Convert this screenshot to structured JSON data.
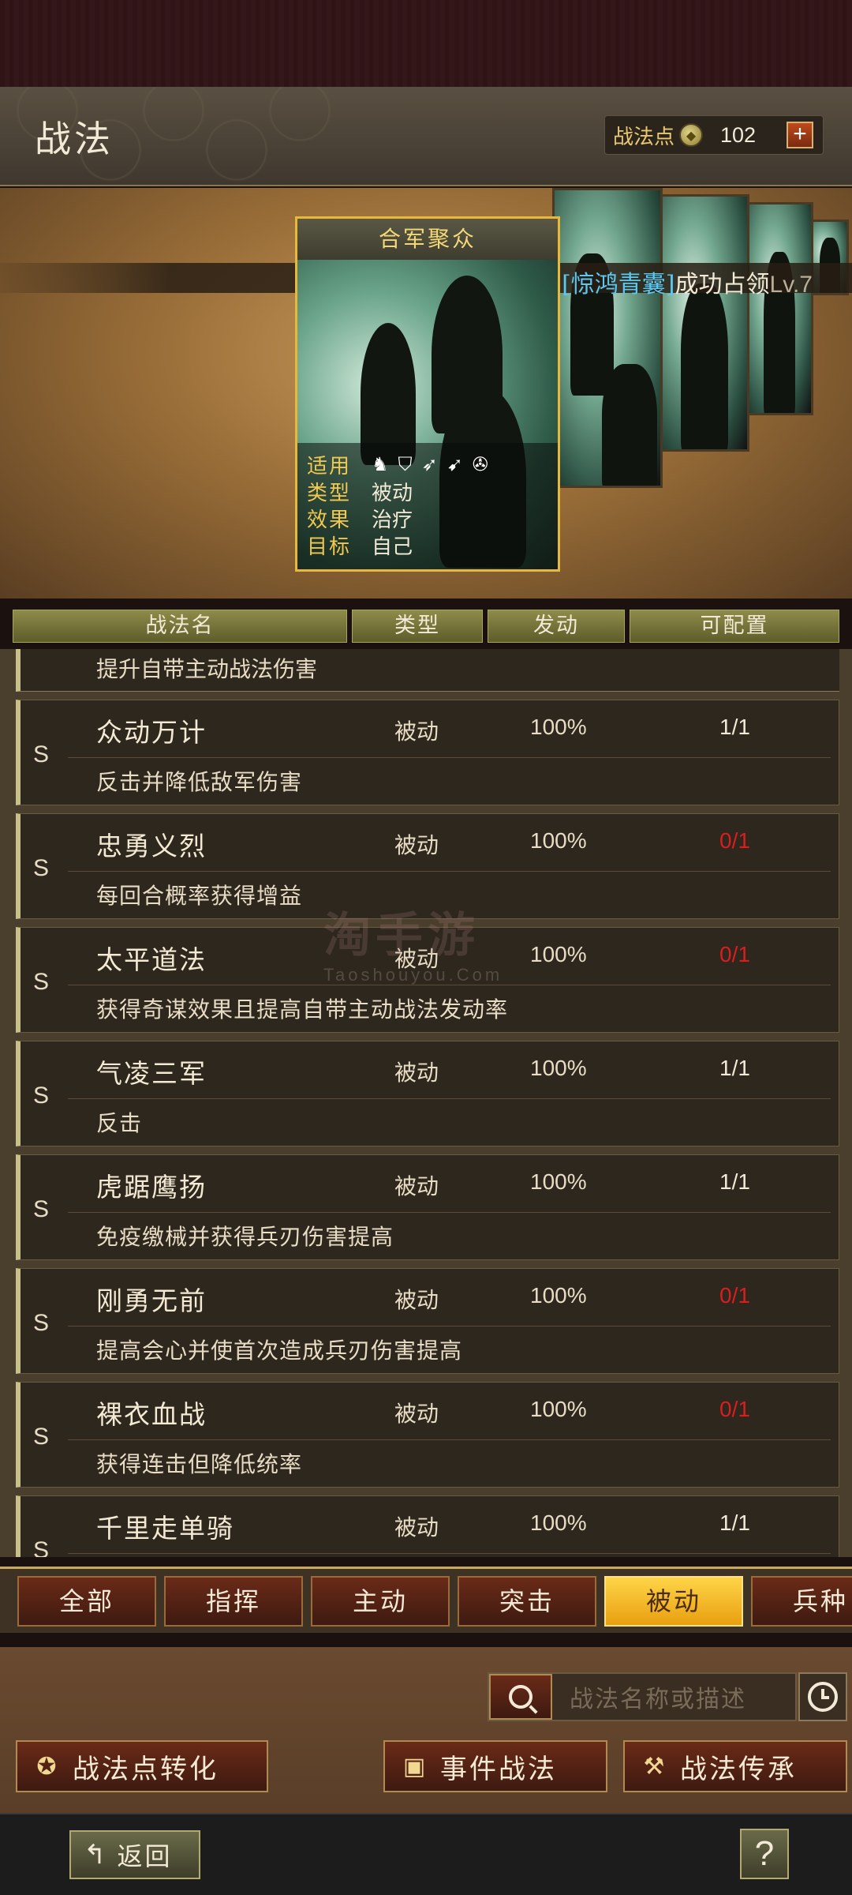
{
  "header": {
    "title": "战法",
    "points_label": "战法点",
    "points_icon": "coin-icon",
    "points_value": "102",
    "plus_label": "+"
  },
  "featured": {
    "owner_tag": "[惊鸿青囊]",
    "owner_text": "成功占领",
    "owner_level": "Lv.7",
    "card_title": "合军聚众",
    "stats": {
      "applicable_key": "适用",
      "applicable_icons": [
        "cavalry-icon",
        "shield-icon",
        "bow-icon",
        "spear-icon",
        "wheel-icon"
      ],
      "type_key": "类型",
      "type_val": "被动",
      "effect_key": "效果",
      "effect_val": "治疗",
      "target_key": "目标",
      "target_val": "自己"
    }
  },
  "table": {
    "headers": [
      "战法名",
      "类型",
      "发动",
      "可配置"
    ],
    "partial_desc": "提升自带主动战法伤害",
    "rows": [
      {
        "grade": "S",
        "name": "众动万计",
        "type": "被动",
        "rate": "100%",
        "cfg": "1/1",
        "cfg_red": false,
        "desc": "反击并降低敌军伤害"
      },
      {
        "grade": "S",
        "name": "忠勇义烈",
        "type": "被动",
        "rate": "100%",
        "cfg": "0/1",
        "cfg_red": true,
        "desc": "每回合概率获得增益"
      },
      {
        "grade": "S",
        "name": "太平道法",
        "type": "被动",
        "rate": "100%",
        "cfg": "0/1",
        "cfg_red": true,
        "desc": "获得奇谋效果且提高自带主动战法发动率"
      },
      {
        "grade": "S",
        "name": "气凌三军",
        "type": "被动",
        "rate": "100%",
        "cfg": "1/1",
        "cfg_red": false,
        "desc": "反击"
      },
      {
        "grade": "S",
        "name": "虎踞鹰扬",
        "type": "被动",
        "rate": "100%",
        "cfg": "1/1",
        "cfg_red": false,
        "desc": "免疫缴械并获得兵刃伤害提高"
      },
      {
        "grade": "S",
        "name": "刚勇无前",
        "type": "被动",
        "rate": "100%",
        "cfg": "0/1",
        "cfg_red": true,
        "desc": "提高会心并使首次造成兵刃伤害提高"
      },
      {
        "grade": "S",
        "name": "裸衣血战",
        "type": "被动",
        "rate": "100%",
        "cfg": "0/1",
        "cfg_red": true,
        "desc": "获得连击但降低统率"
      },
      {
        "grade": "S",
        "name": "千里走单骑",
        "type": "被动",
        "rate": "100%",
        "cfg": "1/1",
        "cfg_red": false,
        "desc": ""
      }
    ]
  },
  "watermark": {
    "main": "淘手游",
    "sub": "Taoshouyou.Com"
  },
  "filters": [
    "全部",
    "指挥",
    "主动",
    "突击",
    "被动",
    "兵种"
  ],
  "active_filter": "被动",
  "search": {
    "placeholder": "战法名称或描述"
  },
  "actions": {
    "convert": "战法点转化",
    "event": "事件战法",
    "inherit": "战法传承"
  },
  "footer": {
    "back": "返回",
    "help": "?"
  },
  "colors": {
    "accent_gold": "#e8b83a",
    "red_cfg": "#d81e1e",
    "active_tab": "#ffd448"
  }
}
